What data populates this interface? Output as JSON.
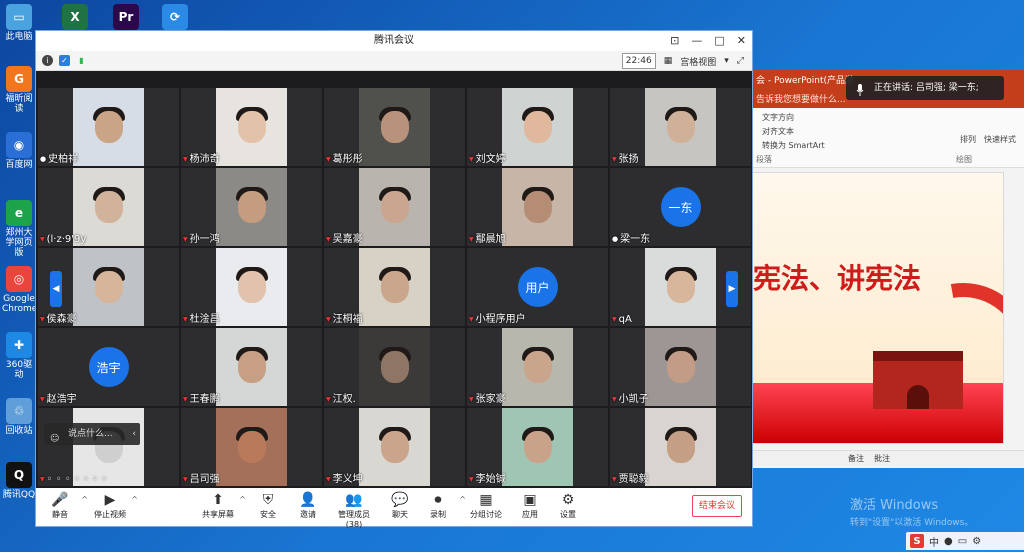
{
  "desktop": {
    "left_icons": [
      {
        "label": "此电脑",
        "glyph": "▭",
        "color": "#4aa3df"
      },
      {
        "label": "福昕阅读",
        "glyph": "G",
        "color": "#f0771e"
      },
      {
        "label": "百度网",
        "glyph": "◉",
        "color": "#2a6fd6"
      },
      {
        "label": "郑州大学网页版",
        "glyph": "e",
        "color": "#1da34a"
      },
      {
        "label": "Google Chrome",
        "glyph": "◎",
        "color": "#e8453c"
      },
      {
        "label": "360驱动",
        "glyph": "✚",
        "color": "#1e88e5"
      },
      {
        "label": "回收站",
        "glyph": "♲",
        "color": "#5f9ed8"
      },
      {
        "label": "腾讯QQ",
        "glyph": "Q",
        "color": "#111111"
      }
    ],
    "top_icons": [
      {
        "glyph": "X",
        "color": "#1f7244"
      },
      {
        "glyph": "Pr",
        "color": "#2a0a4a"
      },
      {
        "glyph": "⟳",
        "color": "#2b8ae6"
      }
    ]
  },
  "ppt": {
    "title": "会 - PowerPoint(产品激",
    "search_hint": "告诉我您想要做什么...",
    "ribbon_items": [
      "文字方向",
      "对齐文本",
      "转换为 SmartArt"
    ],
    "group_paragraph": "段落",
    "group_drawing": "绘图",
    "arrange_label": "排列",
    "quick_style_label": "快速样式",
    "slide_text": "宪法、讲宪法",
    "notes_label": "备注",
    "comments_label": "批注"
  },
  "speaking": {
    "text": "正在讲话: 吕司强; 梁一东;"
  },
  "activation": {
    "line1": "激活 Windows",
    "line2": "转到\"设置\"以激活 Windows。"
  },
  "tray": {
    "ime": "S",
    "lang": "中"
  },
  "meeting": {
    "title": "腾讯会议",
    "time": "22:46",
    "view_mode": "宫格视图",
    "participants": [
      {
        "name": "史柏祥",
        "type": "video",
        "skin": "#c9a487",
        "bg": "#d7dde6"
      },
      {
        "name": "杨沛奇",
        "type": "video",
        "skin": "#e2c2a8",
        "bg": "#e7e3de"
      },
      {
        "name": "葛彤彤",
        "type": "video",
        "skin": "#b8927a",
        "bg": "#50504c"
      },
      {
        "name": "刘文婷",
        "type": "video",
        "skin": "#e0b89e",
        "bg": "#cfd3d2"
      },
      {
        "name": "张扬",
        "type": "video",
        "skin": "#cfb19a",
        "bg": "#c7c5c2"
      },
      {
        "name": "(l·z·9ꞌ9y",
        "type": "video",
        "skin": "#d1b29b",
        "bg": "#dcdad4"
      },
      {
        "name": "孙一鸿",
        "type": "video",
        "skin": "#c49c80",
        "bg": "#8c8a86"
      },
      {
        "name": "吴嘉豪",
        "type": "video",
        "skin": "#caa690",
        "bg": "#b9b4ae"
      },
      {
        "name": "鄢晨旭",
        "type": "video",
        "skin": "#b58d74",
        "bg": "#c7b6a7"
      },
      {
        "name": "梁一东",
        "type": "avatar",
        "avatar": "一东"
      },
      {
        "name": "侯森豪",
        "type": "video",
        "skin": "#d6b59b",
        "bg": "#bfc3c8"
      },
      {
        "name": "杜淦昌",
        "type": "video",
        "skin": "#e0c2ad",
        "bg": "#e9ebee"
      },
      {
        "name": "汪桐福",
        "type": "video",
        "skin": "#c9a68c",
        "bg": "#d8d2c6"
      },
      {
        "name": "小程序用户",
        "type": "avatar",
        "avatar": "用户"
      },
      {
        "name": "qA",
        "type": "video",
        "skin": "#d8b69c",
        "bg": "#dadcdc"
      },
      {
        "name": "赵浩宇",
        "type": "avatar",
        "avatar": "浩宇"
      },
      {
        "name": "王春鹏",
        "type": "video",
        "skin": "#c79f85",
        "bg": "#d5d7d7"
      },
      {
        "name": "江权.",
        "type": "video",
        "skin": "#8f7564",
        "bg": "#3c3a38"
      },
      {
        "name": "张家豪",
        "type": "video",
        "skin": "#c8a58b",
        "bg": "#b8b7ae"
      },
      {
        "name": "小凯子",
        "type": "video",
        "skin": "#c29c86",
        "bg": "#9d9694"
      },
      {
        "name": "◦ ◦ ◦ ◦ ◦ ◦ ◦",
        "type": "video",
        "skin": "#cfcfcf",
        "bg": "#e6e6e6"
      },
      {
        "name": "吕司强",
        "type": "video",
        "skin": "#b87a5a",
        "bg": "#a5705a"
      },
      {
        "name": "李义坤",
        "type": "video",
        "skin": "#caa58c",
        "bg": "#d9d7d2"
      },
      {
        "name": "李始铖",
        "type": "video",
        "skin": "#c9a389",
        "bg": "#9fc6b2"
      },
      {
        "name": "贾聪毅",
        "type": "video",
        "skin": "#c49f86",
        "bg": "#d9d4cf"
      }
    ],
    "chat_placeholder": "说点什么...",
    "toolbar": [
      {
        "label": "静音",
        "icon": "🎤",
        "caret": true
      },
      {
        "label": "停止视频",
        "icon": "▶",
        "caret": true
      },
      {
        "label": "共享屏幕",
        "icon": "⬆",
        "caret": true
      },
      {
        "label": "安全",
        "icon": "⛨",
        "caret": false
      },
      {
        "label": "邀请",
        "icon": "👤",
        "caret": false
      },
      {
        "label": "管理成员(38)",
        "icon": "👥",
        "caret": false
      },
      {
        "label": "聊天",
        "icon": "💬",
        "caret": false
      },
      {
        "label": "录制",
        "icon": "⏺",
        "caret": true
      },
      {
        "label": "分组讨论",
        "icon": "▦",
        "caret": false
      },
      {
        "label": "应用",
        "icon": "▣",
        "caret": false
      },
      {
        "label": "设置",
        "icon": "⚙",
        "caret": false
      }
    ],
    "end_label": "结束会议"
  }
}
